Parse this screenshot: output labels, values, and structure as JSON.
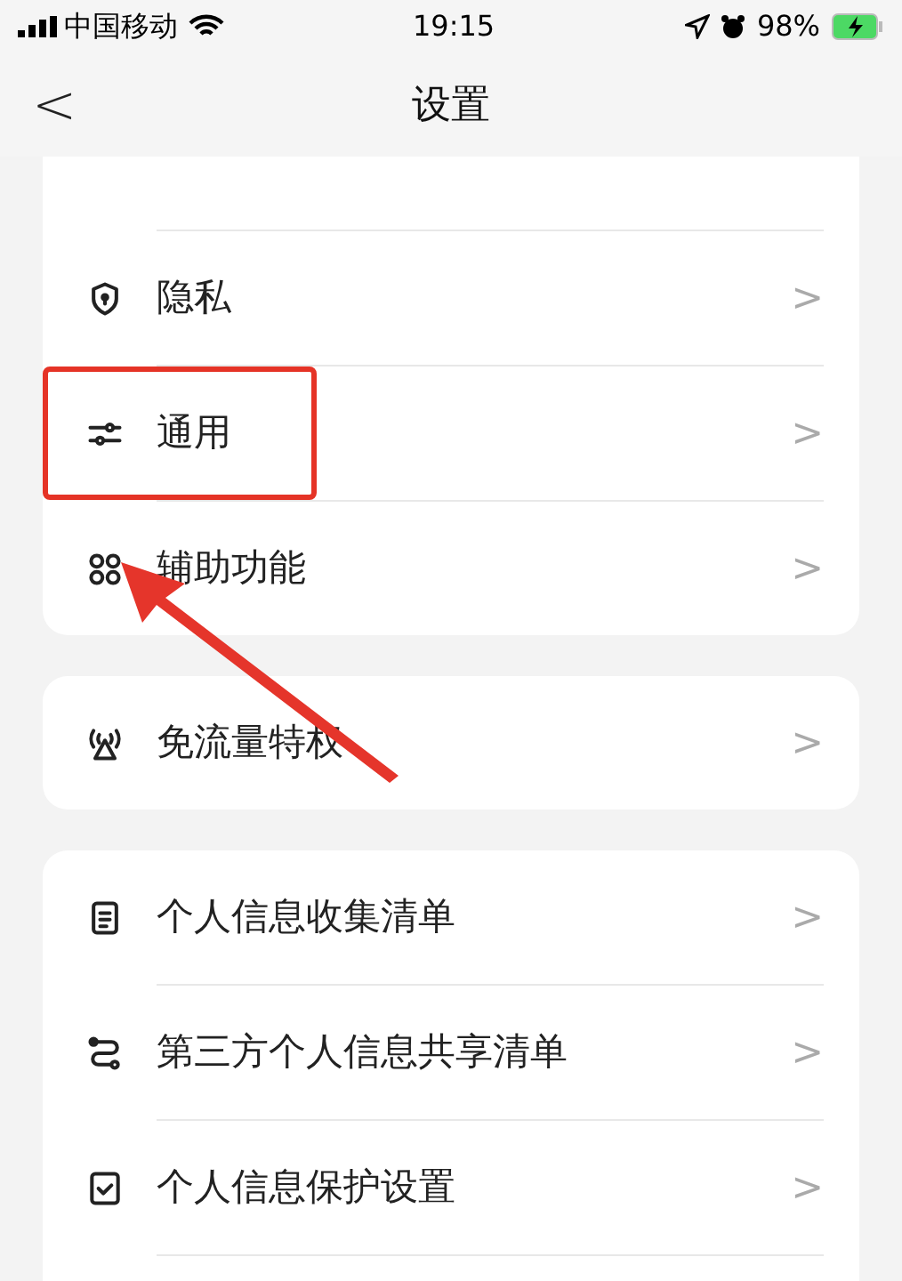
{
  "status_bar": {
    "carrier": "中国移动",
    "time": "19:15",
    "battery": "98%"
  },
  "nav": {
    "back": "<",
    "title": "设置"
  },
  "groups": [
    {
      "items": [
        {
          "label": "隐私",
          "chevron": ">",
          "highlighted": false
        },
        {
          "label": "通用",
          "chevron": ">",
          "highlighted": true
        },
        {
          "label": "辅助功能",
          "chevron": ">",
          "highlighted": false
        }
      ]
    },
    {
      "items": [
        {
          "label": "免流量特权",
          "chevron": ">",
          "highlighted": false
        }
      ]
    },
    {
      "items": [
        {
          "label": "个人信息收集清单",
          "chevron": ">",
          "highlighted": false
        },
        {
          "label": "第三方个人信息共享清单",
          "chevron": ">",
          "highlighted": false
        },
        {
          "label": "个人信息保护设置",
          "chevron": ">",
          "highlighted": false
        }
      ]
    }
  ],
  "annotations": [
    {
      "kind": "arrow"
    }
  ]
}
